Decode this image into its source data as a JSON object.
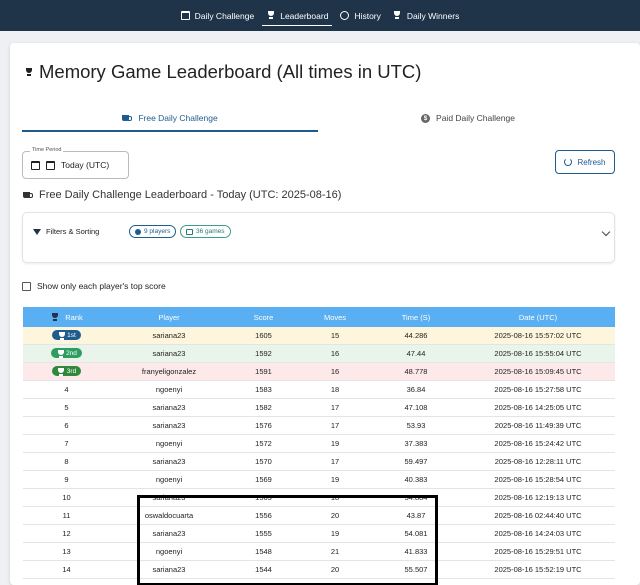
{
  "nav": {
    "items": [
      {
        "label": "Daily Challenge",
        "icon": "calendar-icon"
      },
      {
        "label": "Leaderboard",
        "icon": "trophy-icon"
      },
      {
        "label": "History",
        "icon": "history-icon"
      },
      {
        "label": "Daily Winners",
        "icon": "trophy-icon"
      }
    ]
  },
  "page": {
    "title": "Memory Game Leaderboard (All times in UTC)"
  },
  "tabs": [
    {
      "label": "Free Daily Challenge",
      "icon": "cup-icon"
    },
    {
      "label": "Paid Daily Challenge",
      "icon": "dollar-icon"
    }
  ],
  "period": {
    "legend": "Time Period",
    "value": "Today (UTC)"
  },
  "refresh_label": "Refresh",
  "subtitle": "Free Daily Challenge Leaderboard - Today (UTC: 2025-08-16)",
  "filters": {
    "label": "Filters & Sorting",
    "players_chip": "9 players",
    "games_chip": "36 games"
  },
  "checkbox_label": "Show only each player's top score",
  "table": {
    "headers": [
      "Rank",
      "Player",
      "Score",
      "Moves",
      "Time (S)",
      "Date (UTC)"
    ],
    "rows": [
      {
        "rank": "1st",
        "player": "sariana23",
        "score": "1605",
        "moves": "15",
        "time": "44.286",
        "date": "2025-08-16 15:57:02 UTC"
      },
      {
        "rank": "2nd",
        "player": "sariana23",
        "score": "1592",
        "moves": "16",
        "time": "47.44",
        "date": "2025-08-16 15:55:04 UTC"
      },
      {
        "rank": "3rd",
        "player": "franyeligonzalez",
        "score": "1591",
        "moves": "16",
        "time": "48.778",
        "date": "2025-08-16 15:09:45 UTC"
      },
      {
        "rank": "4",
        "player": "ngoenyi",
        "score": "1583",
        "moves": "18",
        "time": "36.84",
        "date": "2025-08-16 15:27:58 UTC"
      },
      {
        "rank": "5",
        "player": "sariana23",
        "score": "1582",
        "moves": "17",
        "time": "47.108",
        "date": "2025-08-16 14:25:05 UTC"
      },
      {
        "rank": "6",
        "player": "sariana23",
        "score": "1576",
        "moves": "17",
        "time": "53.93",
        "date": "2025-08-16 11:49:39 UTC"
      },
      {
        "rank": "7",
        "player": "ngoenyi",
        "score": "1572",
        "moves": "19",
        "time": "37.383",
        "date": "2025-08-16 15:24:42 UTC"
      },
      {
        "rank": "8",
        "player": "sariana23",
        "score": "1570",
        "moves": "17",
        "time": "59.497",
        "date": "2025-08-16 12:28:11 UTC"
      },
      {
        "rank": "9",
        "player": "ngoenyi",
        "score": "1569",
        "moves": "19",
        "time": "40.383",
        "date": "2025-08-16 15:28:54 UTC"
      },
      {
        "rank": "10",
        "player": "sariana23",
        "score": "1565",
        "moves": "18",
        "time": "54.884",
        "date": "2025-08-16 12:19:13 UTC"
      },
      {
        "rank": "11",
        "player": "oswaldocuarta",
        "score": "1556",
        "moves": "20",
        "time": "43.87",
        "date": "2025-08-16 02:44:40 UTC"
      },
      {
        "rank": "12",
        "player": "sariana23",
        "score": "1555",
        "moves": "19",
        "time": "54.081",
        "date": "2025-08-16 14:24:03 UTC"
      },
      {
        "rank": "13",
        "player": "ngoenyi",
        "score": "1548",
        "moves": "21",
        "time": "41.833",
        "date": "2025-08-16 15:29:51 UTC"
      },
      {
        "rank": "14",
        "player": "sariana23",
        "score": "1544",
        "moves": "20",
        "time": "55.507",
        "date": "2025-08-16 15:52:19 UTC"
      }
    ]
  },
  "colors": {
    "nav_bg": "#1f3349",
    "accent": "#1f5c8e",
    "table_header": "#5aaef2",
    "gold_row": "#fdf5dc",
    "silver_row": "#e9f5ea",
    "bronze_row": "#fde9ea"
  }
}
